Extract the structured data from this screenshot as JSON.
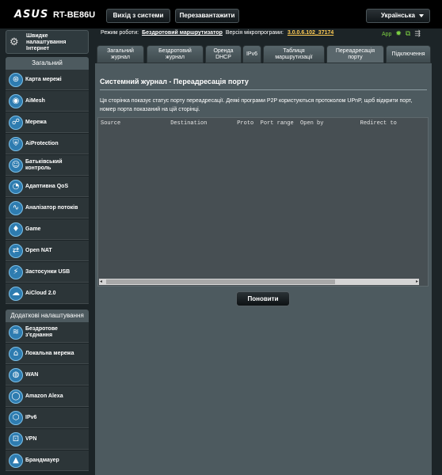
{
  "header": {
    "brand": "ASUS",
    "model": "RT-BE86U",
    "logout_label": "Вихід з системи",
    "reboot_label": "Перезавантажити",
    "language": "Українська"
  },
  "status": {
    "mode_label": "Режим роботи:",
    "mode_value": "Бездротовий маршрутизатор",
    "fw_label": "Версія мікропрограми:",
    "fw_value": "3.0.0.6.102_37174",
    "app_label": "App"
  },
  "sidebar": {
    "qis_label": "Швидке\nналаштування\nІнтернет",
    "general_heading": "Загальний",
    "general_items": [
      {
        "label": "Карта мережі",
        "icon": "network-map-icon"
      },
      {
        "label": "AiMesh",
        "icon": "aimesh-icon"
      },
      {
        "label": "Мережа",
        "icon": "guest-network-icon"
      },
      {
        "label": "AiProtection",
        "icon": "aiprotection-icon"
      },
      {
        "label": "Батьківський\nконтроль",
        "icon": "parental-control-icon"
      },
      {
        "label": "Адаптивна QoS",
        "icon": "qos-icon"
      },
      {
        "label": "Аналізатор потоків",
        "icon": "traffic-analyzer-icon"
      },
      {
        "label": "Game",
        "icon": "game-icon"
      },
      {
        "label": "Open NAT",
        "icon": "open-nat-icon"
      },
      {
        "label": "Застосунки USB",
        "icon": "usb-icon"
      },
      {
        "label": "AiCloud 2.0",
        "icon": "aicloud-icon"
      }
    ],
    "advanced_heading": "Додаткові налаштування",
    "advanced_items": [
      {
        "label": "Бездротове\nз'єднання",
        "icon": "wireless-icon"
      },
      {
        "label": "Локальна мережа",
        "icon": "lan-icon"
      },
      {
        "label": "WAN",
        "icon": "wan-icon"
      },
      {
        "label": "Amazon Alexa",
        "icon": "alexa-icon"
      },
      {
        "label": "IPv6",
        "icon": "ipv6-icon"
      },
      {
        "label": "VPN",
        "icon": "vpn-icon"
      },
      {
        "label": "Брандмауер",
        "icon": "firewall-icon"
      }
    ]
  },
  "tabs": [
    {
      "label": "Загальний\nжурнал"
    },
    {
      "label": "Бездротовий\nжурнал"
    },
    {
      "label": "Оренда\nDHCP"
    },
    {
      "label": "IPv6"
    },
    {
      "label": "Таблиця\nмаршрутизації"
    },
    {
      "label": "Переадресація\nпорту",
      "active": true
    },
    {
      "label": "Підключення"
    }
  ],
  "main": {
    "title": "Системний журнал - Переадресація порту",
    "description": "Ця сторінка показує статус порту переадресації. Деякі програми P2P користуються протоколом UPnP, щоб відкрити порт, номер порта показаний на цій сторінці.",
    "log_header": "Source               Destination         Proto  Port range  Open by           Redirect to",
    "refresh_label": "Поновити"
  }
}
